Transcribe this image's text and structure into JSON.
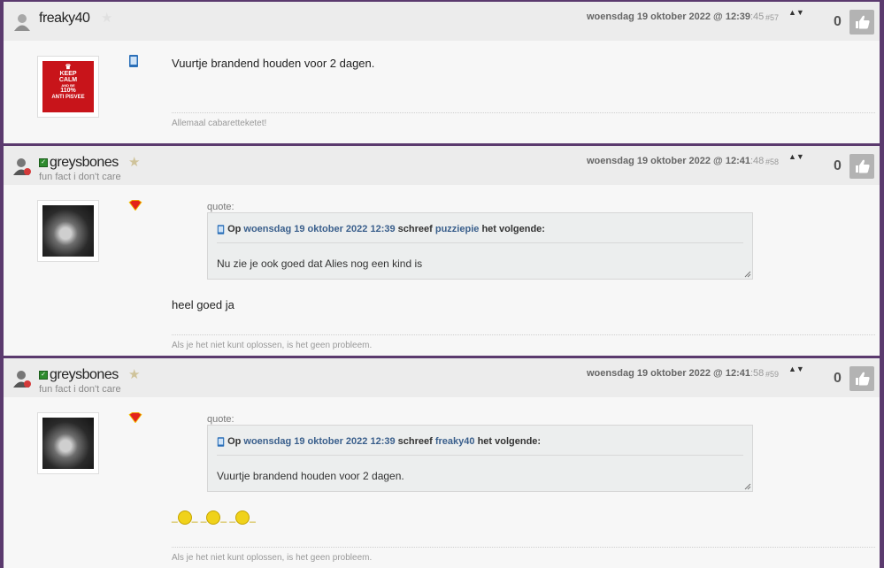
{
  "posts": [
    {
      "username": "freaky40",
      "timestamp_main": "woensdag 19 oktober 2022 @ 12:39",
      "timestamp_sec": ":45",
      "post_number": "#57",
      "votes": "0",
      "body": "Vuurtje brandend houden voor 2 dagen.",
      "signature": "Allemaal cabaretteketet!",
      "avatar_text": [
        "KEEP",
        "CALM",
        "AND BE",
        "110%",
        "ANTI PISVEE"
      ]
    },
    {
      "username": "greysbones",
      "subtitle": "fun fact i don't care",
      "timestamp_main": "woensdag 19 oktober 2022 @ 12:41",
      "timestamp_sec": ":48",
      "post_number": "#58",
      "votes": "0",
      "quote_label": "quote:",
      "quote": {
        "prefix": "Op",
        "date": "woensdag 19 oktober 2022 12:39",
        "wrote": "schreef",
        "author": "puzziepie",
        "suffix": "het volgende:",
        "text": "Nu zie je ook goed dat Alies nog een kind is"
      },
      "body": "heel goed ja",
      "signature": "Als je het niet kunt oplossen, is het geen probleem."
    },
    {
      "username": "greysbones",
      "subtitle": "fun fact i don't care",
      "timestamp_main": "woensdag 19 oktober 2022 @ 12:41",
      "timestamp_sec": ":58",
      "post_number": "#59",
      "votes": "0",
      "quote_label": "quote:",
      "quote": {
        "prefix": "Op",
        "date": "woensdag 19 oktober 2022 12:39",
        "wrote": "schreef",
        "author": "freaky40",
        "suffix": "het volgende:",
        "text": "Vuurtje brandend houden voor 2 dagen."
      },
      "signature": "Als je het niet kunt oplossen, is het geen probleem."
    }
  ],
  "colors": {
    "link": "#3a5f8c",
    "border": "#5b3a6e",
    "online": "#2e8b2e"
  },
  "icons": [
    "user-icon",
    "online-check-icon",
    "star-icon",
    "sort-arrows-icon",
    "thumbs-up-icon",
    "mobile-device-icon",
    "superman-icon",
    "smiley-icon",
    "resize-grip-icon"
  ]
}
